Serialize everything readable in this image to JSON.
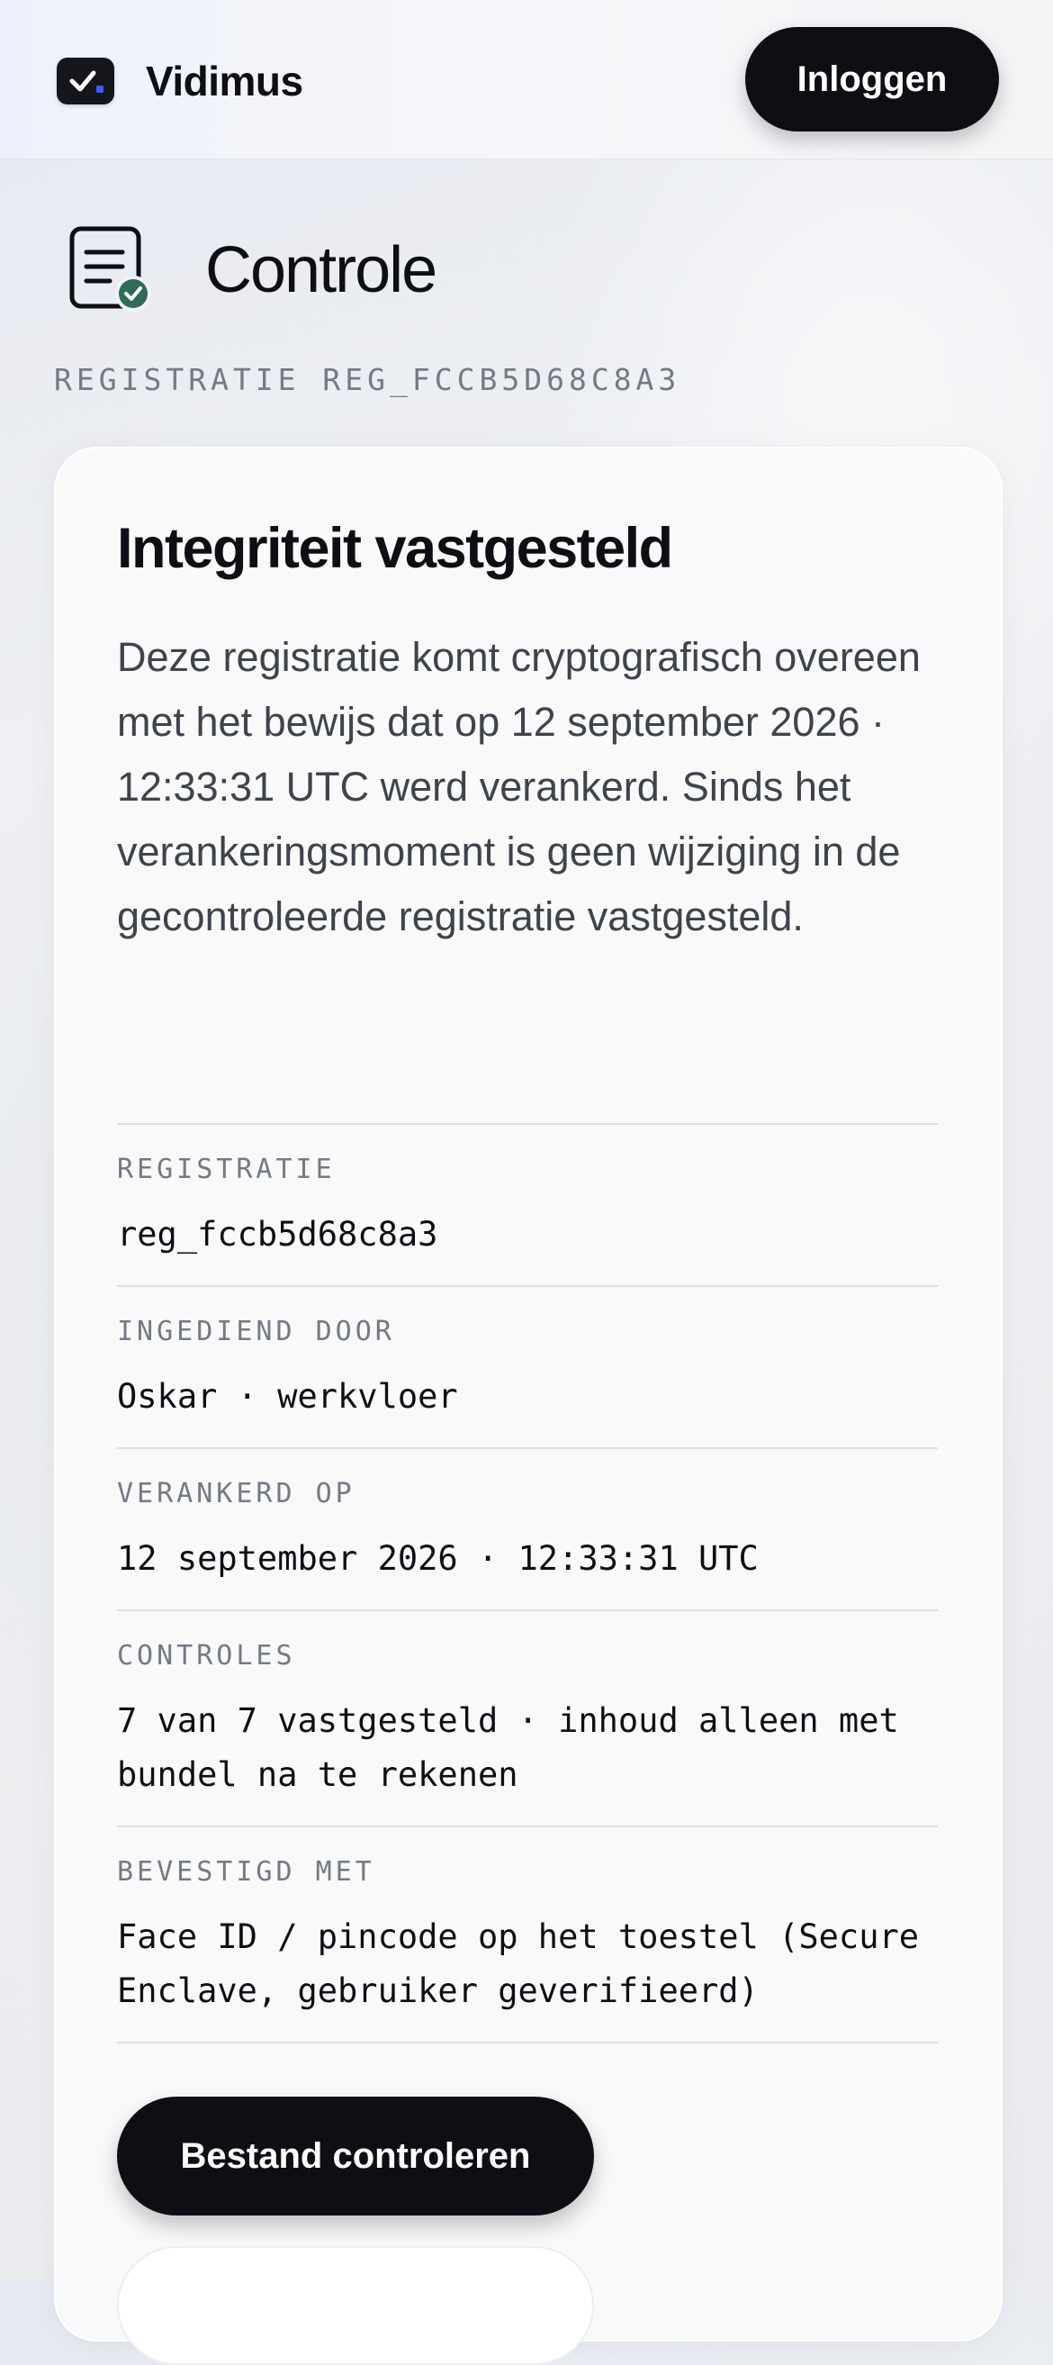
{
  "header": {
    "brand_name": "Vidimus",
    "login_label": "Inloggen"
  },
  "page": {
    "title": "Controle",
    "registration_heading": "REGISTRATIE REG_FCCB5D68C8A3"
  },
  "card": {
    "title": "Integriteit vastgesteld",
    "description": "Deze registratie komt cryptografisch overeen met het bewijs dat op 12 september 2026 · 12:33:31 UTC werd verankerd. Sinds het verankeringsmoment is geen wijziging in de gecontroleerde registratie vastgesteld.",
    "rows": [
      {
        "label": "REGISTRATIE",
        "value": "reg_fccb5d68c8a3"
      },
      {
        "label": "INGEDIEND DOOR",
        "value": "Oskar · werkvloer"
      },
      {
        "label": "VERANKERD OP",
        "value": "12 september 2026 · 12:33:31 UTC"
      },
      {
        "label": "CONTROLES",
        "value": "7 van 7 vastgesteld · inhoud alleen met bundel na te rekenen"
      },
      {
        "label": "BEVESTIGD MET",
        "value": "Face ID / pincode op het toestel (Secure Enclave, gebruiker geverifieerd)"
      }
    ],
    "primary_button_label": "Bestand controleren"
  },
  "colors": {
    "primary": "#0d0f14",
    "muted_label": "#737a86",
    "check_badge": "#2f6b57",
    "logo_dot": "#3b5bff"
  },
  "icons": {
    "logo": "checkbox-check-icon",
    "title": "document-check-icon"
  }
}
